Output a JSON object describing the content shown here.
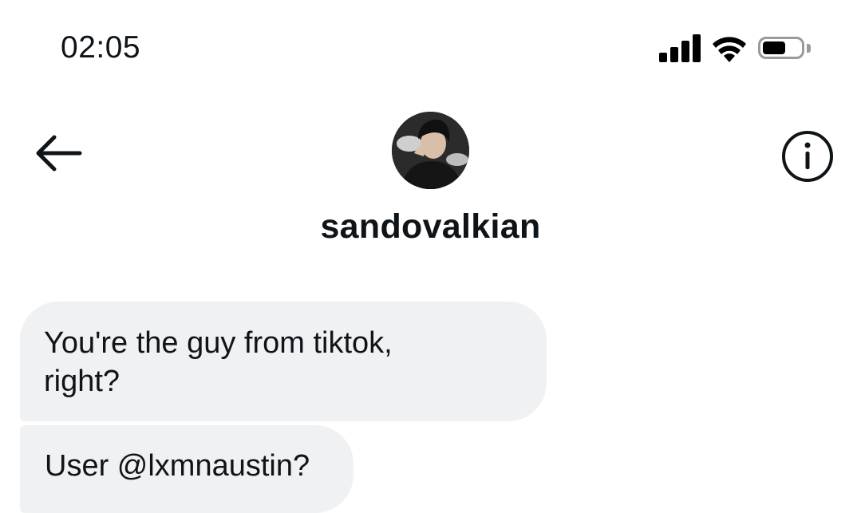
{
  "status_bar": {
    "time": "02:05",
    "icons": [
      "signal-icon",
      "wifi-icon",
      "battery-icon"
    ]
  },
  "header": {
    "back_icon": "arrow-left-icon",
    "info_icon": "info-icon",
    "username": "sandovalkian"
  },
  "messages": [
    {
      "text_line1": "You're the guy from tiktok,",
      "text_line2": "right?"
    },
    {
      "text": "User @lxmnaustin?"
    }
  ],
  "colors": {
    "bubble_bg": "#eff1f3",
    "text": "#0f1419"
  }
}
